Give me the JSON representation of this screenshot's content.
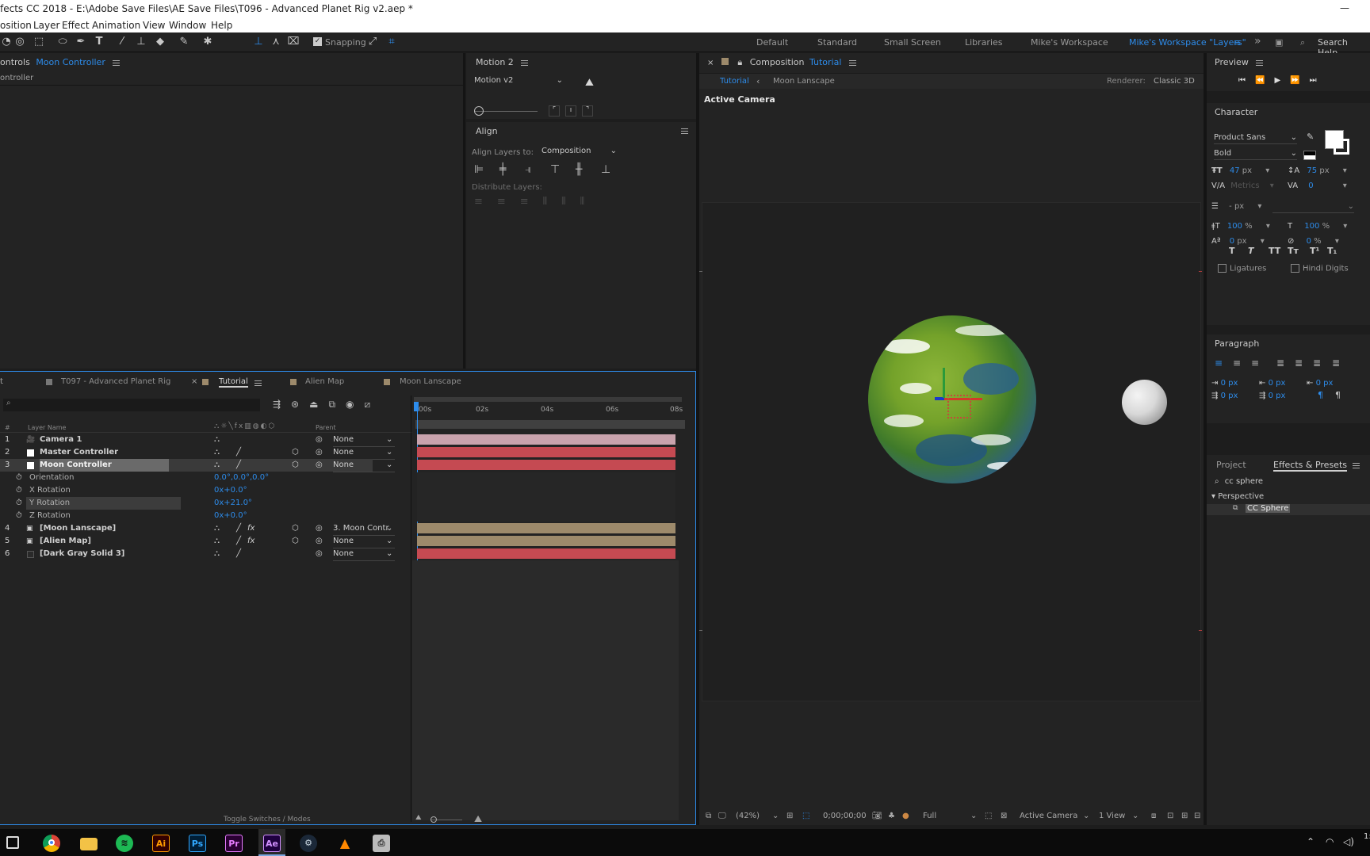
{
  "app": {
    "title": "fects CC 2018 - E:\\Adobe Save Files\\AE Save Files\\T096 - Advanced Planet Rig v2.aep *"
  },
  "menu": [
    "osition",
    "Layer",
    "Effect",
    "Animation",
    "View",
    "Window",
    "Help"
  ],
  "toolbar": {
    "snapping_label": "Snapping",
    "workspaces": [
      "Default",
      "Standard",
      "Small Screen",
      "Libraries",
      "Mike's Workspace",
      "Mike's Workspace \"Layers\""
    ],
    "active_workspace": "Mike's Workspace \"Layers\"",
    "search_help": "Search Help"
  },
  "effect_controls": {
    "header_prefix": "ontrols",
    "layer": "Moon Controller",
    "subheader": "ontroller"
  },
  "motion": {
    "title": "Motion 2",
    "preset": "Motion v2"
  },
  "align": {
    "title": "Align",
    "align_to_label": "Align Layers to:",
    "align_to_value": "Composition",
    "distribute_label": "Distribute Layers:"
  },
  "composition": {
    "prefix": "Composition",
    "name": "Tutorial",
    "breadcrumb_active": "Tutorial",
    "breadcrumb_other": "Moon Lanscape",
    "renderer_label": "Renderer:",
    "renderer_value": "Classic 3D",
    "camera_label": "Active Camera"
  },
  "viewer_footer": {
    "zoom": "(42%)",
    "timecode": "0;00;00;00",
    "resolution": "Full",
    "view": "Active Camera",
    "views": "1 View"
  },
  "preview": {
    "title": "Preview"
  },
  "character": {
    "title": "Character",
    "font": "Product Sans",
    "style": "Bold",
    "size": "47",
    "size_unit": "px",
    "leading": "75",
    "leading_unit": "px",
    "kerning": "Metrics",
    "tracking": "0",
    "stroke": "- px",
    "vscale": "100",
    "hscale": "100",
    "pct": "%",
    "baseline": "0",
    "baseline_unit": "px",
    "tsume": "0",
    "tsume_unit": "%",
    "style_buttons": [
      "T",
      "T",
      "TT",
      "Tт",
      "T¹",
      "T₁"
    ],
    "ligatures": "Ligatures",
    "hindi_digits": "Hindi Digits"
  },
  "paragraph": {
    "title": "Paragraph",
    "indents": [
      "0 px",
      "0 px",
      "0 px",
      "0 px",
      "0 px"
    ]
  },
  "project_tabs": {
    "project": "Project",
    "effects": "Effects & Presets",
    "search": "cc sphere",
    "category": "Perspective",
    "result": "CC Sphere"
  },
  "timeline": {
    "tabs": [
      "t",
      "T097 - Advanced Planet Rig",
      "Tutorial",
      "Alien Map",
      "Moon Lanscape"
    ],
    "active_tab": "Tutorial",
    "col_num": "#",
    "col_layer": "Layer Name",
    "col_parent": "Parent",
    "ruler": [
      "00s",
      "02s",
      "04s",
      "06s",
      "08s"
    ],
    "toggle_label": "Toggle Switches / Modes",
    "layers": [
      {
        "num": "1",
        "name": "Camera 1",
        "parent": "None",
        "color": "#c9a3ad"
      },
      {
        "num": "2",
        "name": "Master Controller",
        "parent": "None",
        "color": "#c54a52"
      },
      {
        "num": "3",
        "name": "Moon Controller",
        "parent": "None",
        "color": "#c54a52"
      },
      {
        "num": "4",
        "name": "[Moon Lanscape]",
        "parent": "3. Moon Contr",
        "color": "#9d8a6b"
      },
      {
        "num": "5",
        "name": "[Alien Map]",
        "parent": "None",
        "color": "#9d8a6b"
      },
      {
        "num": "6",
        "name": "[Dark Gray Solid 3]",
        "parent": "None",
        "color": "#c54a52"
      }
    ],
    "properties": [
      {
        "name": "Orientation",
        "value": "0.0°,0.0°,0.0°"
      },
      {
        "name": "X Rotation",
        "value": "0x+0.0°"
      },
      {
        "name": "Y Rotation",
        "value": "0x+21.0°"
      },
      {
        "name": "Z Rotation",
        "value": "0x+0.0°"
      }
    ]
  },
  "taskbar": {
    "apps": [
      "chrome",
      "files",
      "spotify",
      "Ai",
      "Ps",
      "Pr",
      "Ae",
      "steam",
      "vlc",
      "printer"
    ],
    "clock_fragment": "1:"
  }
}
